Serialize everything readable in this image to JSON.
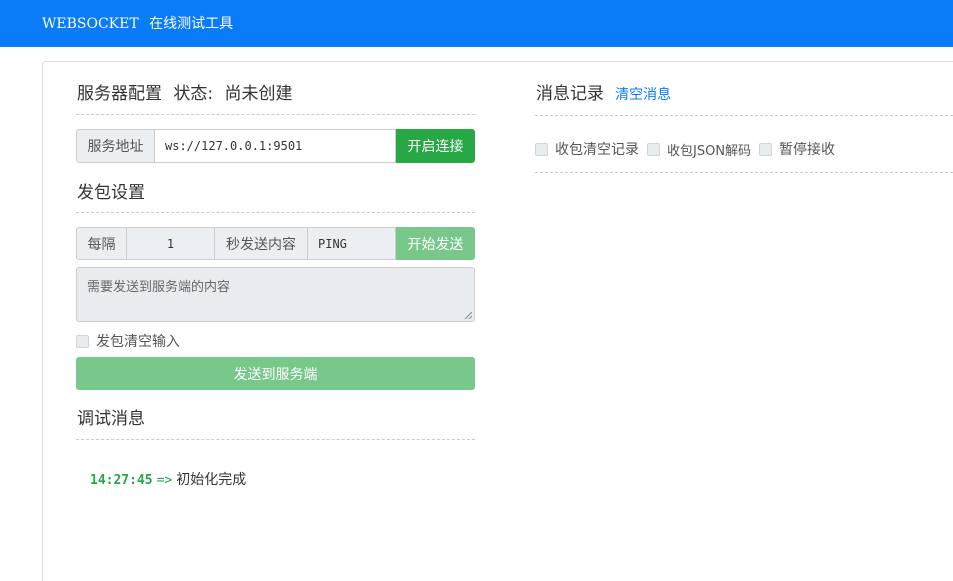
{
  "navbar": {
    "brand_en": "WEBSOCKET",
    "brand_cn": "在线测试工具"
  },
  "server": {
    "title": "服务器配置",
    "status_label": "状态:",
    "status_value": "尚未创建",
    "address_label": "服务地址",
    "address_value": "ws://127.0.0.1:9501",
    "connect_label": "开启连接"
  },
  "send_settings": {
    "title": "发包设置",
    "every_label": "每隔",
    "interval_value": "1",
    "seconds_label": "秒发送内容",
    "content_value": "PING",
    "start_label": "开始发送",
    "textarea_placeholder": "需要发送到服务端的内容",
    "clear_input_label": "发包清空输入",
    "send_button_label": "发送到服务端"
  },
  "debug": {
    "title": "调试消息",
    "logs": [
      {
        "time": "14:27:45",
        "arrow": "=>",
        "message": "初始化完成"
      }
    ]
  },
  "messages": {
    "title": "消息记录",
    "clear_link": "清空消息",
    "options": [
      "收包清空记录",
      "收包JSON解码",
      "暂停接收"
    ]
  },
  "colors": {
    "navbar": "#0a7cf8",
    "success": "#28a745",
    "success_light": "#78c88b",
    "link": "#0a7cf8"
  }
}
